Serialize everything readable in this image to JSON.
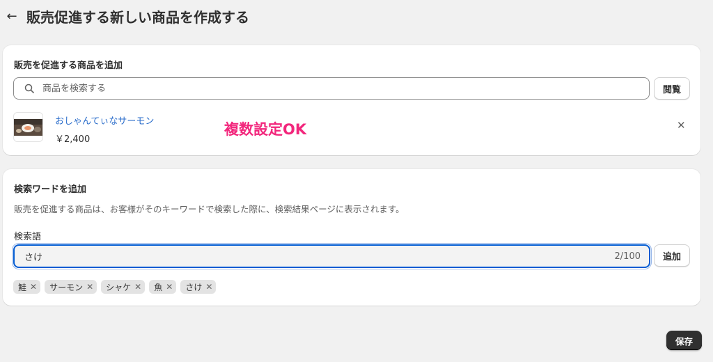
{
  "header": {
    "title": "販売促進する新しい商品を作成する",
    "back_icon": "arrow-left-icon"
  },
  "product_card": {
    "heading": "販売を促進する商品を追加",
    "search_placeholder": "商品を検索する",
    "browse_label": "閲覧",
    "product": {
      "name": "おしゃんてぃなサーモン",
      "price": "￥2,400"
    },
    "annotation": "複数設定OK",
    "remove_icon": "close-icon"
  },
  "keyword_card": {
    "heading": "検索ワードを追加",
    "help_text": "販売を促進する商品は、お客様がそのキーワードで検索した際に、検索結果ページに表示されます。",
    "field_label": "検索語",
    "field_value": "さけ",
    "char_count": "2/100",
    "add_label": "追加",
    "tags": [
      "鮭",
      "サーモン",
      "シャケ",
      "魚",
      "さけ"
    ]
  },
  "footer": {
    "save_label": "保存"
  },
  "colors": {
    "accent": "#005bd3",
    "link": "#2c6ecb",
    "annotation": "#f2267c",
    "primary_button": "#303030"
  }
}
